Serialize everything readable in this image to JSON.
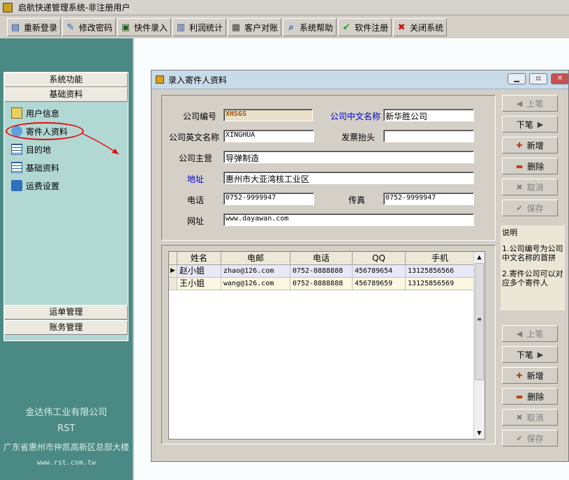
{
  "window": {
    "title": "启航快递管理系统-非注册用户"
  },
  "toolbar": [
    {
      "label": "重新登录",
      "icon": "relogin-icon"
    },
    {
      "label": "修改密码",
      "icon": "edit-password-icon"
    },
    {
      "label": "快件录入",
      "icon": "package-entry-icon"
    },
    {
      "label": "利润统计",
      "icon": "profit-stats-icon"
    },
    {
      "label": "客户对账",
      "icon": "reconcile-icon"
    },
    {
      "label": "系统帮助",
      "icon": "help-icon"
    },
    {
      "label": "软件注册",
      "icon": "check-icon"
    },
    {
      "label": "关闭系统",
      "icon": "close-icon"
    }
  ],
  "sidebar": {
    "headers": [
      "系统功能",
      "基础资料"
    ],
    "items": [
      "用户信息",
      "寄件人资料",
      "目的地",
      "基础资料",
      "运费设置"
    ],
    "bottom_headers": [
      "运单管理",
      "账务管理"
    ],
    "footer": {
      "company": "金达伟工业有限公司",
      "code": "RST",
      "address": "广东省惠州市仲凯高新区总部大楼",
      "website": "www.rst.com.tw"
    }
  },
  "dialog": {
    "title": "录入寄件人资料",
    "form": {
      "company_code_label": "公司编号",
      "company_code": "XHSGS",
      "company_cn_label": "公司中文名称",
      "company_cn": "新华胜公司",
      "company_en_label": "公司英文名称",
      "company_en": "XINGHUA",
      "invoice_label": "发票抬头",
      "invoice": "",
      "business_label": "公司主营",
      "business": "导弹制造",
      "address_label": "地址",
      "address": "惠州市大亚湾核工业区",
      "phone_label": "电话",
      "phone": "0752-9999947",
      "fax_label": "传真",
      "fax": "0752-9999947",
      "web_label": "网址",
      "web": "www.dayawan.com"
    },
    "grid": {
      "headers": [
        "姓名",
        "电邮",
        "电话",
        "QQ",
        "手机"
      ],
      "rows": [
        [
          "赵小姐",
          "zhao@126.com",
          "0752-8888888",
          "456789654",
          "13125856566"
        ],
        [
          "王小姐",
          "wang@126.com",
          "0752-8888888",
          "456789659",
          "13125856569"
        ]
      ]
    },
    "buttons": {
      "prev": "上笔",
      "next": "下笔",
      "add": "新增",
      "delete": "删除",
      "cancel": "取消",
      "save": "保存"
    },
    "note": {
      "title": "说明",
      "line1": "1.公司编号为公司中文名称的首拼",
      "line2": "2.寄件公司可以对应多个寄件人"
    }
  }
}
